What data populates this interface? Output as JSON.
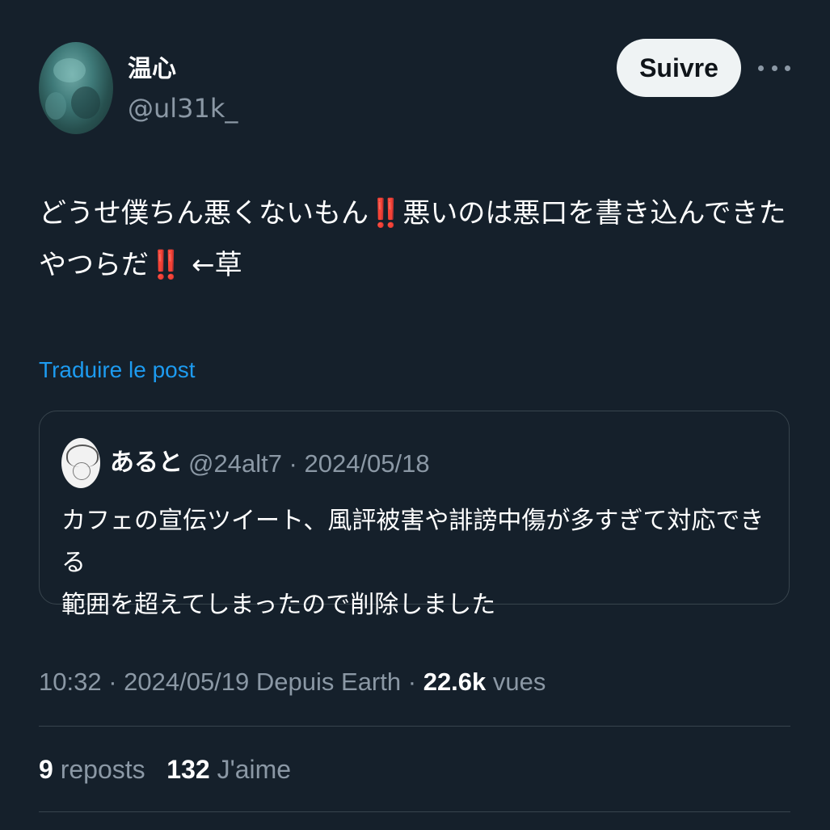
{
  "author": {
    "display_name": "温心",
    "handle": "@ul31k_"
  },
  "follow_label": "Suivre",
  "more_icon": "more-horizontal-icon",
  "tweet": {
    "line1": "どうせ僕ちん悪くないもん‼️悪いのは悪口を書き込んできた",
    "line2": "やつらだ‼️ ←草"
  },
  "translate_label": "Traduire le post",
  "quote": {
    "display_name": "あると",
    "meta": "@24alt7 · 2024/05/18",
    "line1": "カフェの宣伝ツイート、風評被害や誹謗中傷が多すぎて対応できる",
    "line2": "範囲を超えてしまったので削除しました"
  },
  "post_meta": {
    "time_date": "10:32 · 2024/05/19",
    "source": "Depuis Earth",
    "separator": "·",
    "views_count": "22.6k",
    "views_label": "vues"
  },
  "stats": {
    "reposts_count": "9",
    "reposts_label": "reposts",
    "likes_count": "132",
    "likes_label": "J'aime"
  },
  "colors": {
    "background": "#15202b",
    "accent": "#1d9bf0",
    "muted": "#8b98a5",
    "border": "#38444d"
  }
}
